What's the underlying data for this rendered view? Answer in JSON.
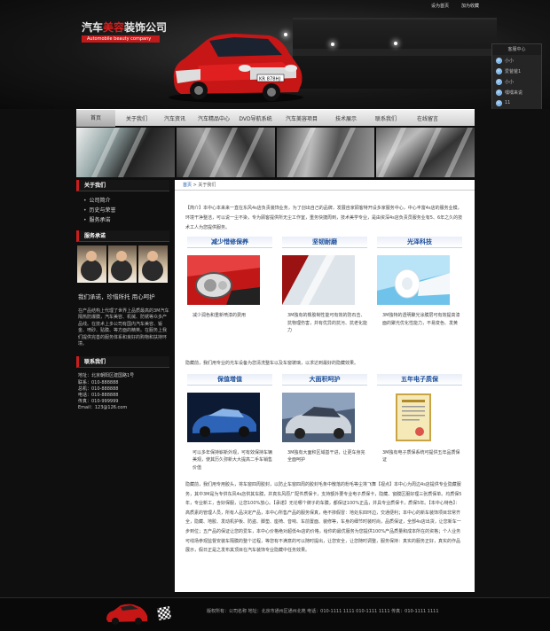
{
  "top_links": {
    "home": "设为首页",
    "favorite": "加为收藏"
  },
  "logo": {
    "cn_white_a": "汽车",
    "cn_red": "美容",
    "cn_white_b": "装饰公司",
    "en": "Automobile beauty company"
  },
  "car": {
    "plate": "KR 878HJ"
  },
  "service_panel": {
    "title": "客服中心",
    "items": [
      "小小",
      "爱爸爸1",
      "小小",
      "嘿嘿来说",
      "11"
    ]
  },
  "nav": [
    "首页",
    "关于我们",
    "汽车资讯",
    "汽车精品中心",
    "DVD导航系统",
    "汽车美容项目",
    "技术展示",
    "联系我们",
    "在线留言"
  ],
  "sidebar": {
    "about_title": "关于我们",
    "about_items": [
      "公司简介",
      "历史与荣誉",
      "服务承诺"
    ],
    "service_title": "服务承诺",
    "slogan": "我们承诺，珍惜所托 用心呵护",
    "service_text": "在产品结构上代理了世界上品质最高的3M汽车隔热防爆膜，汽车美容、机械、防锈等众多产品线。在技术上多公司有国内汽车美容、钣金、喷砂、贴膜、等方面的精英。在服务上我们提供完善的服务体系和良好的购物和扶持环境。",
    "contact_title": "联系我们",
    "contact_lines": [
      "地址：北京朝阳区建国路1号",
      "联系：010-888888",
      "总机：010-888888",
      "电话：010-888888",
      "传真：010-999999",
      "Email：123@126.com"
    ]
  },
  "breadcrumb": {
    "home": "首页",
    "sep": " > ",
    "current": "关于我们"
  },
  "intro": "【简介】本中心本来来一直在东风4s店负责装饰业务，为了创出自己的品牌，发展自家顾客特开设多家服务中心，中心丰富4s店的服务业模，环境干净整洁，可以说一尘不染，专为顾客提供所无尘工作室，重务快捷周到，技术美学专业，是由资深4s店负责员服务业有5、6年之久的技术工人为您提供服务。",
  "features_row1": [
    {
      "title": "减少惜修保养",
      "desc": "减少润色和重新喷漆的费用"
    },
    {
      "title": "坚韧耐磨",
      "desc": "3M独有的橡胶制性能可有效的防石击、抗物理伤害，并有优异的抗污、抗老化能力"
    },
    {
      "title": "光泽科技",
      "desc": "3M独特的透明聚光涂膜层可有效提高漆面的聚光优化性能力，不易变色、发黄"
    }
  ],
  "mid_text": "隐藏前，我们用专业的光车设备为您清洗整车以及车窗玻璃，以求达到最好的隐藏效果。",
  "features_row2": [
    {
      "title": "保值增值",
      "desc": "可以多年保持崭新外观，可有效保持车辆美观，使其历久弥新大大提高二手车销售价值"
    },
    {
      "title": "大面积呵护",
      "desc": "3M独有大面积区域基干进，让更车身完全面呵护"
    },
    {
      "title": "五年电子质保",
      "desc": "3M独有电子质保系统可提供五年品质保证"
    }
  ],
  "bottom_text": "隐藏前，我们用专用胶头，将车窗四周胶封，以防止车窗四周的胶封毛条中散落的粉毛等尘埃飞舞【视点】本中心为周边4s店提供专业隐藏服务，其中3M是为专供东风4s店供其车膜，并真东风原厂配件质保卡，支持额外要专业电子质保卡，隐藏、窗膜区服好理三张质保单。均质保5年，专业新工，含好保服，让您100%放心。【承诺】无论哪个牌子的车膜，都保证100%正品，并具专业质保卡，质保5年。【本中心特色】：高质素的管理人员，所有人品决定产品，本中心所售产品的服务保真，绝不掺假冒：地处东四环边，交通便利；本中心的新车装饰项目非常齐全，隐藏、地胶、发动机护板、防盗、脚垫、座椅、音响、车前置面、装修等，车身的细节时装时尚，品质保证，全部4s店出货，让您新车一步到位；五产品的保证让您的爱车，本中心价格绝对超低4s店的价格，给你的最优服务为您提供100%产品质量和成本所在的资格；个人业务可线场参观监督安装车隔膜的整个过程，等您有不满意的可以随时提出，让您安全，让您随时调整，服务保持：真实的服务正好，真实的作品展示，假日正是之发布其顶目在汽车装饰专业隐藏中任务效果。",
  "footer": {
    "text": "版权所有：公司名称   地址：北京市通州区通州北苑   电话：010-1111 1111   010-1111 1111   传真：010-1111 1111"
  },
  "colors": {
    "accent_red": "#c81e1e",
    "feature_blue": "#1d4f9c",
    "link_blue": "#1d5aa8"
  }
}
